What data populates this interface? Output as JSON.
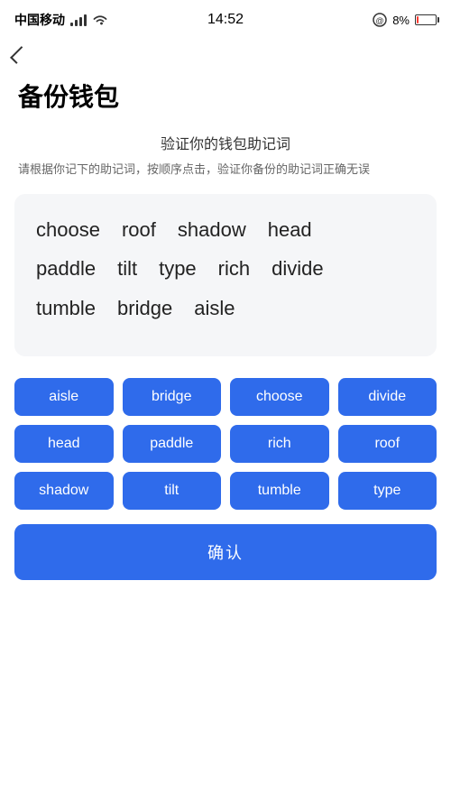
{
  "statusBar": {
    "carrier": "中国移动",
    "time": "14:52",
    "batteryPercent": "8%",
    "batteryLevel": 8
  },
  "navigation": {
    "backLabel": ""
  },
  "page": {
    "title": "备份钱包",
    "sectionTitle": "验证你的钱包助记词",
    "sectionDesc": "请根据你记下的助记词，按顺序点击，验证你备份的助记词正确无误"
  },
  "displayWords": [
    [
      "choose",
      "roof",
      "shadow",
      "head"
    ],
    [
      "paddle",
      "tilt",
      "type",
      "rich",
      "divide"
    ],
    [
      "tumble",
      "bridge",
      "aisle"
    ]
  ],
  "wordButtons": [
    "aisle",
    "bridge",
    "choose",
    "divide",
    "head",
    "paddle",
    "rich",
    "roof",
    "shadow",
    "tilt",
    "tumble",
    "type"
  ],
  "confirmButton": {
    "label": "确认"
  }
}
